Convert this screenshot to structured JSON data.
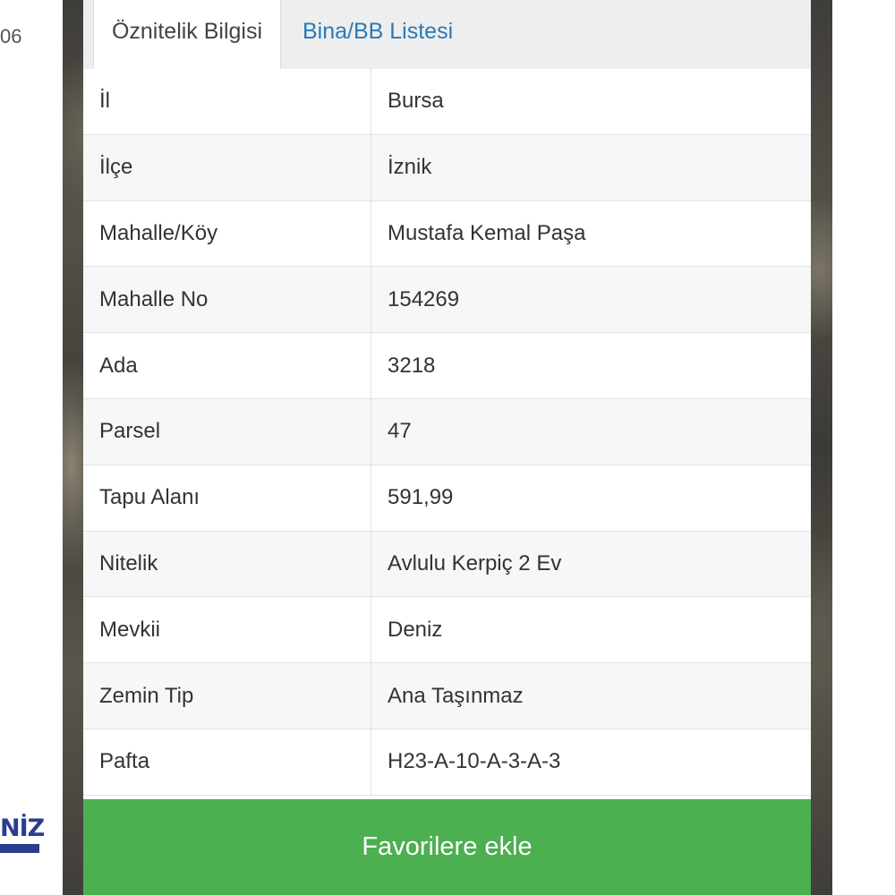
{
  "background": {
    "left_fragment_text": "06",
    "logo_fragment_text": "NİZ"
  },
  "tabs": [
    {
      "label": "Öznitelik Bilgisi",
      "active": true
    },
    {
      "label": "Bina/BB Listesi",
      "active": false
    }
  ],
  "attributes": [
    {
      "key": "İl",
      "value": "Bursa"
    },
    {
      "key": "İlçe",
      "value": "İznik"
    },
    {
      "key": "Mahalle/Köy",
      "value": "Mustafa Kemal Paşa"
    },
    {
      "key": "Mahalle No",
      "value": "154269"
    },
    {
      "key": "Ada",
      "value": "3218"
    },
    {
      "key": "Parsel",
      "value": "47"
    },
    {
      "key": "Tapu Alanı",
      "value": "591,99"
    },
    {
      "key": "Nitelik",
      "value": "Avlulu Kerpiç 2 Ev"
    },
    {
      "key": "Mevkii",
      "value": "Deniz"
    },
    {
      "key": "Zemin Tip",
      "value": "Ana Taşınmaz"
    },
    {
      "key": "Pafta",
      "value": "H23-A-10-A-3-A-3"
    }
  ],
  "favorite_button_label": "Favorilere ekle",
  "colors": {
    "button_green": "#4caf50",
    "tab_link_blue": "#2a7ab8",
    "logo_blue": "#2b3d8f"
  }
}
